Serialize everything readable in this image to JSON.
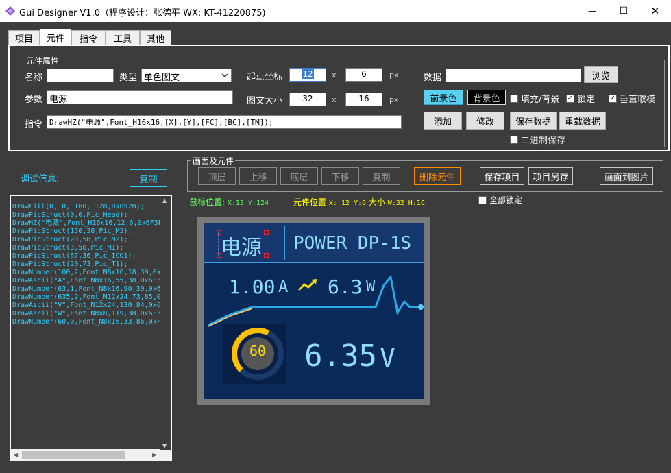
{
  "window": {
    "title": "Gui Designer V1.0（程序设计：张德平 WX: KT-41220875)",
    "minimize": "—",
    "maximize": "☐",
    "close": "✕"
  },
  "tabs": [
    {
      "label": "项目"
    },
    {
      "label": "元件"
    },
    {
      "label": "指令"
    },
    {
      "label": "工具"
    },
    {
      "label": "其他"
    }
  ],
  "props": {
    "legend": "元件属性",
    "name_label": "名称",
    "name_value": "",
    "type_label": "类型",
    "type_value": "单色图文",
    "param_label": "参数",
    "param_value": "电源",
    "cmd_label": "指令",
    "cmd_value": "DrawHZ(\"电源\",Font_H16x16,[X],[Y],[FC],[BC],[TM]);",
    "start_label": "起点坐标",
    "start_x": "12",
    "start_y": "6",
    "size_label": "图文大小",
    "size_w": "32",
    "size_h": "16",
    "x_sep": "x",
    "px": "px",
    "data_label": "数据",
    "data_value": "",
    "browse": "浏览",
    "fg": "前景色",
    "bg": "背景色",
    "fill_bg": "填充/背景",
    "lock": "锁定",
    "vertical": "垂直取模",
    "add": "添加",
    "modify": "修改",
    "save_data": "保存数据",
    "reload_data": "重载数据",
    "binary_save": "二进制保存"
  },
  "debug": {
    "label": "调试信息:",
    "copy": "复制",
    "lines": [
      "DrawFill(0, 0, 160, 128,0x092B);",
      "DrawPicStruct(0,0,Pic_Head);",
      "DrawHZ(\"电源\",Font_H16x16,12,6,0x6F3F,0",
      "DrawPicStruct(130,38,Pic_M3);",
      "DrawPicStruct(28,58,Pic_M2);",
      "DrawPicStruct(3,58,Pic_M1);",
      "DrawPicStruct(67,36,Pic_ICO1);",
      "DrawPicStruct(20,73,Pic_T1);",
      "DrawNumber(100,2,Font_N8x16,18,39,0x6F3",
      "DrawAscii(\"A\",Font_N8x16,55,38,0x6F3F,0",
      "DrawNumber(63,1,Font_N8x16,90,39,0x6F3F",
      "DrawNumber(635,2,Font_N12x24,73,85,0x6F",
      "DrawAscii(\"V\",Font_N12x24,130,84,0x6F3F",
      "DrawAscii(\"W\",Font_N8x8,119,38,0x6F3F,0",
      "DrawNumber(60,0,Font_N8x16,33,86,0xFFE0"
    ]
  },
  "screen": {
    "legend": "画面及元件",
    "top_layer": "顶层",
    "move_up": "上移",
    "bottom_layer": "底层",
    "move_down": "下移",
    "copy": "复制",
    "delete": "删除元件",
    "save_project": "保存项目",
    "save_as": "项目另存",
    "to_image": "画面到图片",
    "mouse_pos_label": "鼠标位置:",
    "mouse_pos": "X:13 Y:124",
    "elem_pos_label": "元件位置",
    "elem_pos": "X: 12 Y:6",
    "size_label": "大小",
    "elem_size": "W:32 H:16",
    "lock_all": "全部锁定"
  },
  "lcd": {
    "title_cn": "电源",
    "title_en": "POWER DP-1S",
    "current": "1.00",
    "current_unit": "A",
    "power": "6.3",
    "power_unit": "W",
    "voltage": "6.35",
    "voltage_unit": "V",
    "gauge": "60",
    "gauge_fraction": 0.6,
    "colors": {
      "bg": "#0a2a5a",
      "header": "#1a3f7a",
      "digits": "#8fdcff",
      "gauge": "#ffc000",
      "accent": "#30d0ff"
    }
  },
  "colors": {
    "panel": "#3c3c3c",
    "cyan": "#30d0ff",
    "green": "#5cff5c",
    "yellow": "#ffff00",
    "orange": "#ff8a00"
  }
}
